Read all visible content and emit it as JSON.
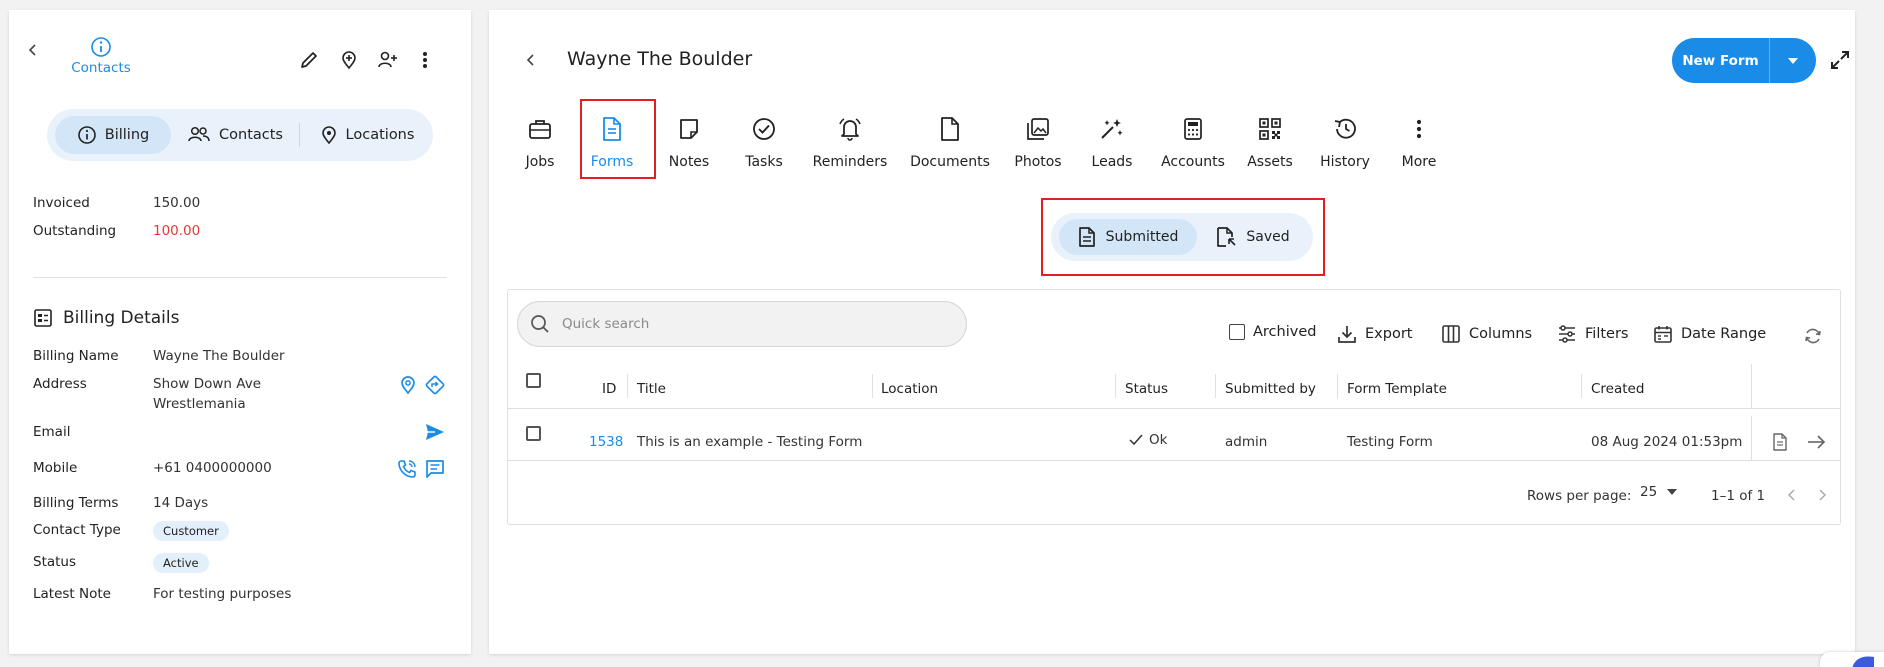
{
  "left": {
    "contacts_label": "Contacts",
    "tabs": [
      {
        "label": "Billing"
      },
      {
        "label": "Contacts"
      },
      {
        "label": "Locations"
      }
    ],
    "summary": {
      "invoiced_label": "Invoiced",
      "invoiced_value": "150.00",
      "outstanding_label": "Outstanding",
      "outstanding_value": "100.00"
    },
    "billing_details": {
      "title": "Billing Details",
      "billing_name_label": "Billing Name",
      "billing_name": "Wayne The Boulder",
      "address_label": "Address",
      "address_line1": "Show Down Ave",
      "address_line2": "Wrestlemania",
      "email_label": "Email",
      "mobile_label": "Mobile",
      "mobile": "+61 0400000000",
      "billing_terms_label": "Billing Terms",
      "billing_terms": "14 Days",
      "contact_type_label": "Contact Type",
      "contact_type": "Customer",
      "status_label": "Status",
      "status": "Active",
      "latest_note_label": "Latest Note",
      "latest_note": "For testing purposes"
    }
  },
  "main": {
    "title": "Wayne The Boulder",
    "new_form_label": "New Form",
    "nav": [
      {
        "label": "Jobs",
        "icon": "briefcase-icon"
      },
      {
        "label": "Forms",
        "icon": "form-document-icon",
        "active": true
      },
      {
        "label": "Notes",
        "icon": "note-icon"
      },
      {
        "label": "Tasks",
        "icon": "check-circle-icon"
      },
      {
        "label": "Reminders",
        "icon": "bell-ringing-icon"
      },
      {
        "label": "Documents",
        "icon": "document-icon"
      },
      {
        "label": "Photos",
        "icon": "photos-icon"
      },
      {
        "label": "Leads",
        "icon": "sparkle-wand-icon"
      },
      {
        "label": "Accounts",
        "icon": "calculator-icon"
      },
      {
        "label": "Assets",
        "icon": "qr-code-icon"
      },
      {
        "label": "History",
        "icon": "history-icon"
      },
      {
        "label": "More",
        "icon": "more-vertical-icon"
      }
    ],
    "toggle": {
      "submitted": "Submitted",
      "saved": "Saved"
    },
    "search_placeholder": "Quick search",
    "toolbar": {
      "archived": "Archived",
      "export": "Export",
      "columns": "Columns",
      "filters": "Filters",
      "date_range": "Date Range"
    },
    "table": {
      "columns": [
        "ID",
        "Title",
        "Location",
        "Status",
        "Submitted by",
        "Form Template",
        "Created"
      ],
      "rows": [
        {
          "id": "1538",
          "title": "This is an example - Testing Form",
          "location": "",
          "status": "Ok",
          "submitted_by": "admin",
          "form_template": "Testing Form",
          "created": "08 Aug 2024 01:53pm"
        }
      ]
    },
    "pagination": {
      "rows_per_page_label": "Rows per page:",
      "rows_per_page": "25",
      "range": "1–1 of 1"
    }
  },
  "colors": {
    "accent": "#1a8ce8",
    "outstanding": "#e53935",
    "highlight": "#e02020"
  }
}
